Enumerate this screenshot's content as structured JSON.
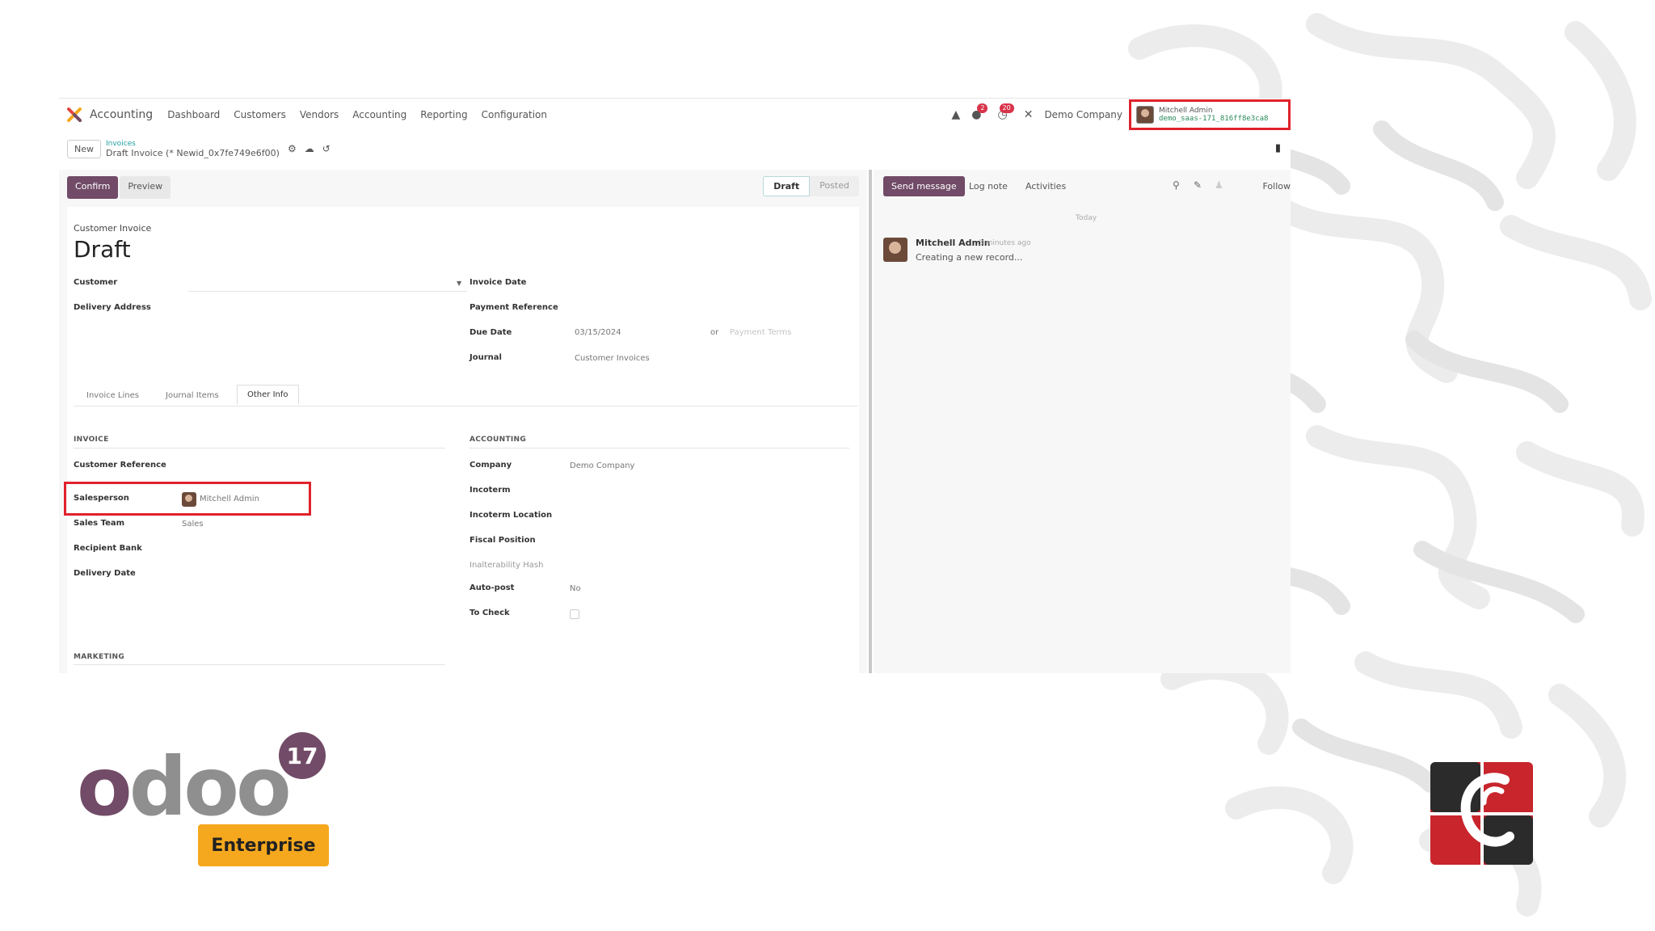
{
  "navbar": {
    "app_name": "Accounting",
    "menu": [
      "Dashboard",
      "Customers",
      "Vendors",
      "Accounting",
      "Reporting",
      "Configuration"
    ],
    "company": "Demo Company",
    "user_name": "Mitchell Admin",
    "user_db": "demo_saas-171_816ff8e3ca8",
    "chat_badge": "2",
    "activity_badge": "20"
  },
  "control": {
    "new_label": "New",
    "breadcrumb_parent": "Invoices",
    "breadcrumb_current": "Draft Invoice (* Newid_0x7fe749e6f00)"
  },
  "form": {
    "confirm_label": "Confirm",
    "preview_label": "Preview",
    "status_draft": "Draft",
    "status_posted": "Posted",
    "doc_type": "Customer Invoice",
    "title": "Draft",
    "fields_left": {
      "customer": "Customer",
      "delivery_address": "Delivery Address"
    },
    "fields_right": {
      "invoice_date": "Invoice Date",
      "payment_reference": "Payment Reference",
      "due_date": "Due Date",
      "due_date_value": "03/15/2024",
      "due_or": "or",
      "payment_terms_placeholder": "Payment Terms",
      "journal": "Journal",
      "journal_value": "Customer Invoices"
    },
    "tabs": [
      "Invoice Lines",
      "Journal Items",
      "Other Info"
    ],
    "invoice_section": {
      "heading": "INVOICE",
      "customer_reference": "Customer Reference",
      "salesperson": "Salesperson",
      "salesperson_value": "Mitchell Admin",
      "sales_team": "Sales Team",
      "sales_team_value": "Sales",
      "recipient_bank": "Recipient Bank",
      "delivery_date": "Delivery Date"
    },
    "accounting_section": {
      "heading": "ACCOUNTING",
      "company": "Company",
      "company_value": "Demo Company",
      "incoterm": "Incoterm",
      "incoterm_location": "Incoterm Location",
      "fiscal_position": "Fiscal Position",
      "inalterability_hash": "Inalterability Hash",
      "auto_post": "Auto-post",
      "auto_post_value": "No",
      "to_check": "To Check"
    },
    "marketing_heading": "MARKETING"
  },
  "chatter": {
    "send_message": "Send message",
    "log_note": "Log note",
    "activities": "Activities",
    "follow": "Follow",
    "today": "Today",
    "author": "Mitchell Admin",
    "time": "3 minutes ago",
    "message": "Creating a new record..."
  },
  "branding": {
    "wordmark": "odoo",
    "version": "17",
    "edition": "Enterprise"
  },
  "colors": {
    "brand_purple": "#714b67",
    "highlight_red": "#e0222c",
    "edition_orange": "#f5a81e",
    "corner_red": "#c8252c",
    "corner_dark": "#2b2b2b"
  }
}
